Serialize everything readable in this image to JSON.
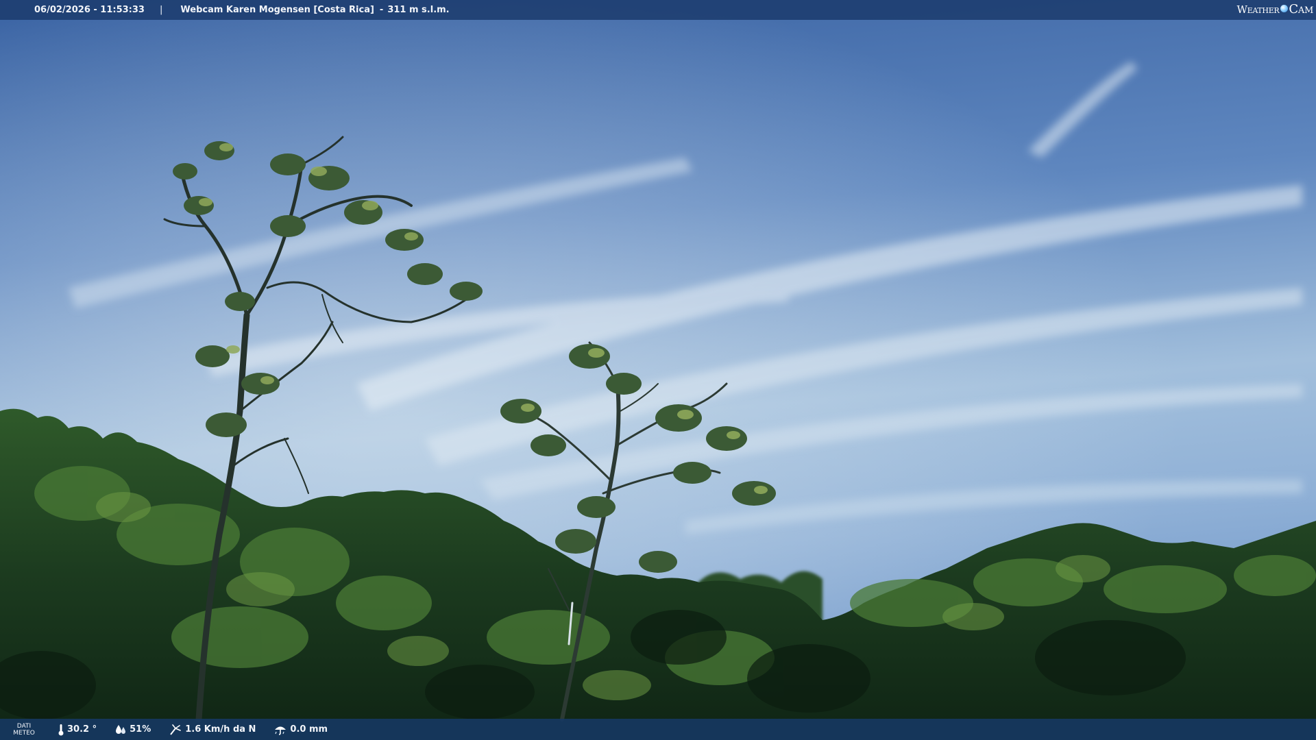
{
  "header": {
    "datetime": "06/02/2026 - 11:53:33",
    "separator": "|",
    "station": "Webcam Karen Mogensen [Costa Rica]",
    "altitude_dash": "-",
    "altitude": "311 m s.l.m."
  },
  "brand": {
    "word_weather": "Weather",
    "word_cam": "Cam"
  },
  "weather_bar": {
    "label_line1": "DATI",
    "label_line2": "METEO",
    "temperature": "30.2 °",
    "humidity": "51%",
    "wind": "1.6 Km/h da N",
    "rain": "0.0 mm",
    "icons": [
      "thermometer-icon",
      "humidity-drop-icon",
      "wind-icon",
      "rain-icon"
    ]
  },
  "colors": {
    "sky_top": "#3f6aa8",
    "sky_horizon": "#a9c4dd",
    "foliage_dark": "#14301c",
    "foliage_light": "#3f6e2f",
    "bar_background": "#1c3c6e"
  }
}
